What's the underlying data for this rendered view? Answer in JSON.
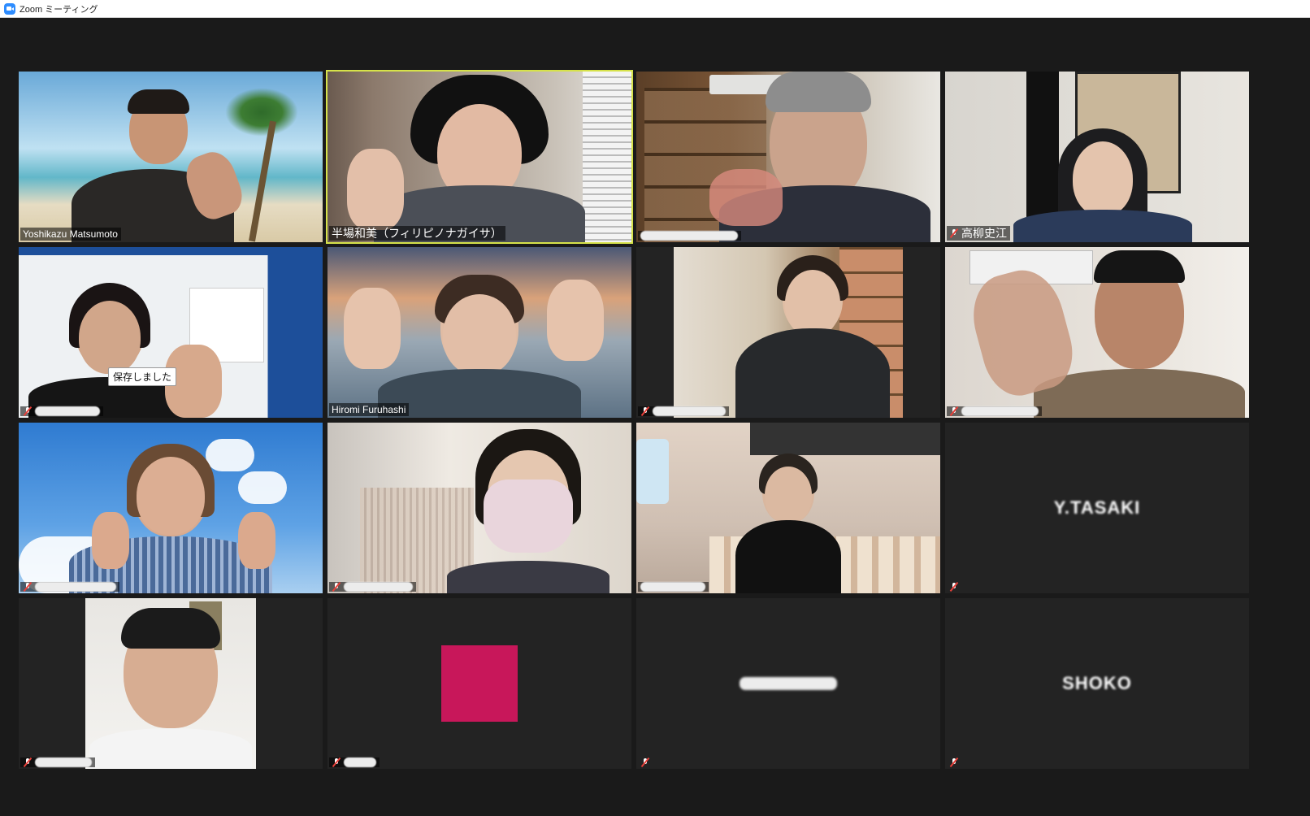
{
  "window": {
    "title": "Zoom ミーティング",
    "icon": "zoom-app-icon"
  },
  "colors": {
    "active_speaker_border": "#d6e24a",
    "muted_mic": "#e8403a",
    "avatar_background": "#c8175a",
    "stage_background": "#1a1a1a",
    "tile_background": "#232323"
  },
  "participants": [
    {
      "name": "Yoshikazu Matsumoto",
      "video": true,
      "muted": false,
      "active": false
    },
    {
      "name": "半場和美（フィリピノナガイサ）",
      "video": true,
      "muted": false,
      "active": true
    },
    {
      "name": "",
      "video": true,
      "muted": false,
      "active": false
    },
    {
      "name": "高柳史江",
      "video": true,
      "muted": true,
      "active": false
    },
    {
      "name": "",
      "video": true,
      "muted": true,
      "active": false,
      "tooltip": "保存しました"
    },
    {
      "name": "Hiromi Furuhashi",
      "video": true,
      "muted": false,
      "active": false
    },
    {
      "name": "",
      "video": true,
      "muted": true,
      "active": false
    },
    {
      "name": "",
      "video": true,
      "muted": true,
      "active": false
    },
    {
      "name": "",
      "video": true,
      "muted": true,
      "active": false
    },
    {
      "name": "",
      "video": true,
      "muted": true,
      "active": false
    },
    {
      "name": "",
      "video": true,
      "muted": false,
      "active": false
    },
    {
      "name": "Y.TASAKI",
      "video": false,
      "muted": true,
      "active": false
    },
    {
      "name": "",
      "video": true,
      "muted": true,
      "active": false
    },
    {
      "name": "",
      "video": false,
      "muted": true,
      "active": false,
      "avatar": true
    },
    {
      "name": "",
      "video": false,
      "muted": true,
      "active": false
    },
    {
      "name": "SHOKO",
      "video": false,
      "muted": true,
      "active": false
    }
  ]
}
